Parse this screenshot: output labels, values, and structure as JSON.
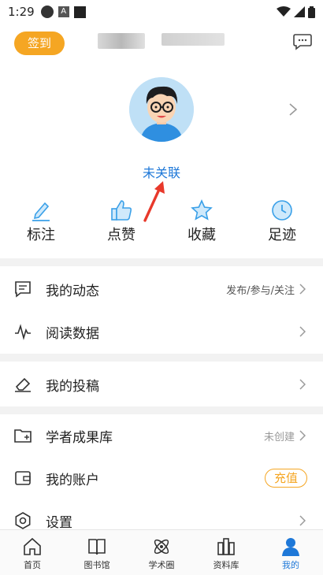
{
  "status_bar": {
    "time": "1:29"
  },
  "header": {
    "checkin_label": "签到"
  },
  "profile": {
    "status_text": "未关联"
  },
  "quick_actions": [
    {
      "label": "标注",
      "icon": "pencil-icon"
    },
    {
      "label": "点赞",
      "icon": "thumbs-up-icon"
    },
    {
      "label": "收藏",
      "icon": "star-icon"
    },
    {
      "label": "足迹",
      "icon": "clock-icon"
    }
  ],
  "menu": {
    "my_activity": {
      "label": "我的动态",
      "value": "发布/参与/关注"
    },
    "reading_data": {
      "label": "阅读数据"
    },
    "my_submissions": {
      "label": "我的投稿"
    },
    "scholar_library": {
      "label": "学者成果库",
      "value": "未创建"
    },
    "my_account": {
      "label": "我的账户",
      "action": "充值"
    },
    "settings": {
      "label": "设置"
    }
  },
  "tabs": [
    {
      "label": "首页",
      "icon": "home-icon"
    },
    {
      "label": "图书馆",
      "icon": "book-icon"
    },
    {
      "label": "学术圈",
      "icon": "atom-icon"
    },
    {
      "label": "资料库",
      "icon": "archive-icon"
    },
    {
      "label": "我的",
      "icon": "user-icon",
      "active": true
    }
  ],
  "colors": {
    "accent": "#1e78d8",
    "checkin": "#f5a623",
    "annotation_arrow": "#e8392b"
  }
}
